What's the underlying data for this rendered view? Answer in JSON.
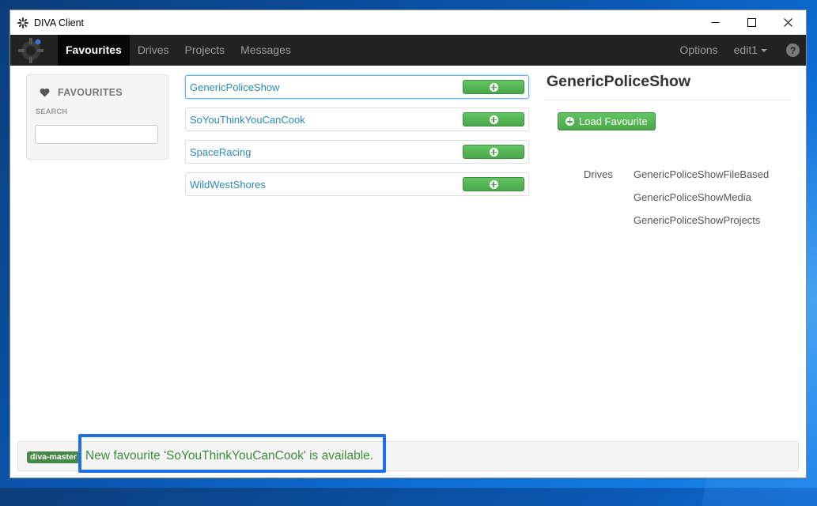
{
  "window": {
    "title": "DIVA Client"
  },
  "navbar": {
    "tabs": [
      {
        "label": "Favourites",
        "active": true
      },
      {
        "label": "Drives",
        "active": false
      },
      {
        "label": "Projects",
        "active": false
      },
      {
        "label": "Messages",
        "active": false
      }
    ],
    "options_label": "Options",
    "user_label": "edit1"
  },
  "sidebar": {
    "title": "FAVOURITES",
    "search_label": "SEARCH",
    "search_value": ""
  },
  "favourites": [
    {
      "name": "GenericPoliceShow",
      "selected": true
    },
    {
      "name": "SoYouThinkYouCanCook",
      "selected": false
    },
    {
      "name": "SpaceRacing",
      "selected": false
    },
    {
      "name": "WildWestShores",
      "selected": false
    }
  ],
  "detail": {
    "title": "GenericPoliceShow",
    "load_button_label": "Load Favourite",
    "drives_label": "Drives",
    "drives": [
      "GenericPoliceShowFileBased",
      "GenericPoliceShowMedia",
      "GenericPoliceShowProjects"
    ]
  },
  "status": {
    "badge": "diva-master",
    "message": "New favourite 'SoYouThinkYouCanCook' is available."
  },
  "colors": {
    "navbar_bg": "#222222",
    "link": "#2a8ab8",
    "success": "#4aa84a",
    "status_text": "#3c8a3c",
    "highlight": "#1f6fe8"
  }
}
